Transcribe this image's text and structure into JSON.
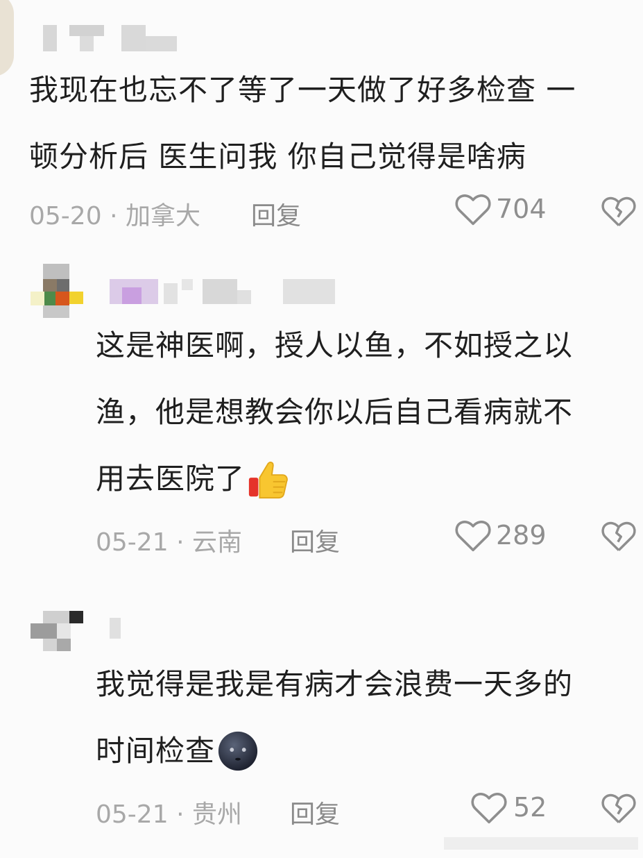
{
  "comments": [
    {
      "text_lines": [
        "我现在也忘不了等了一天做了好多检查 一",
        "顿分析后 医生问我 你自己觉得是啥病"
      ],
      "date": "05-20",
      "sep": "·",
      "location": "加拿大",
      "reply_label": "回复",
      "likes": "704",
      "like_icon": "heart-outline",
      "dislike_icon": "broken-heart-outline"
    },
    {
      "text_lines": [
        "这是神医啊，授人以鱼，不如授之以",
        "渔，他是想教会你以后自己看病就不",
        "用去医院了"
      ],
      "emoji": "thumbs-up",
      "date": "05-21",
      "sep": "·",
      "location": "云南",
      "reply_label": "回复",
      "likes": "289",
      "like_icon": "heart-outline",
      "dislike_icon": "broken-heart-outline"
    },
    {
      "text_lines": [
        "我觉得是我是有病才会浪费一天多的",
        "时间检查"
      ],
      "emoji": "dark-face",
      "date": "05-21",
      "sep": "·",
      "location": "贵州",
      "reply_label": "回复",
      "likes": "52",
      "like_icon": "heart-outline",
      "dislike_icon": "broken-heart-outline"
    }
  ]
}
